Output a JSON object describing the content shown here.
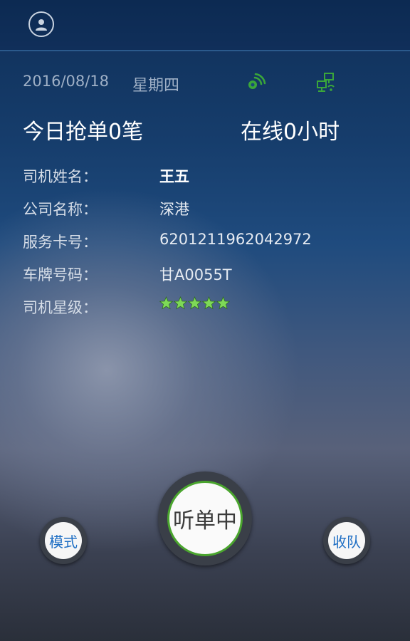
{
  "header": {
    "avatar_icon": "user-avatar-icon",
    "title_color": "#0c2a52"
  },
  "status": {
    "date": "2016/08/18",
    "weekday": "星期四",
    "signal_icon": "gps-signal-icon",
    "network_icon": "network-connection-icon",
    "icon_color": "#3aa63a"
  },
  "stats": {
    "orders_today": "今日抢单0笔",
    "online_hours": "在线0小时"
  },
  "driver_info": {
    "items": [
      {
        "label": "司机姓名：",
        "value": "王五"
      },
      {
        "label": "公司名称：",
        "value": "深港"
      },
      {
        "label": "服务卡号：",
        "value": "6201211962042972"
      },
      {
        "label": "车牌号码：",
        "value": "甘A0055T"
      },
      {
        "label": "司机星级：",
        "value": ""
      }
    ],
    "star_rating": 5,
    "star_max": 5,
    "star_color": "#7ed957"
  },
  "actions": {
    "listen_label": "听单中",
    "mode_label": "模式",
    "queue_label": "收队",
    "accent": "#4aa52e",
    "button_text_color": "#1f6fc4"
  }
}
